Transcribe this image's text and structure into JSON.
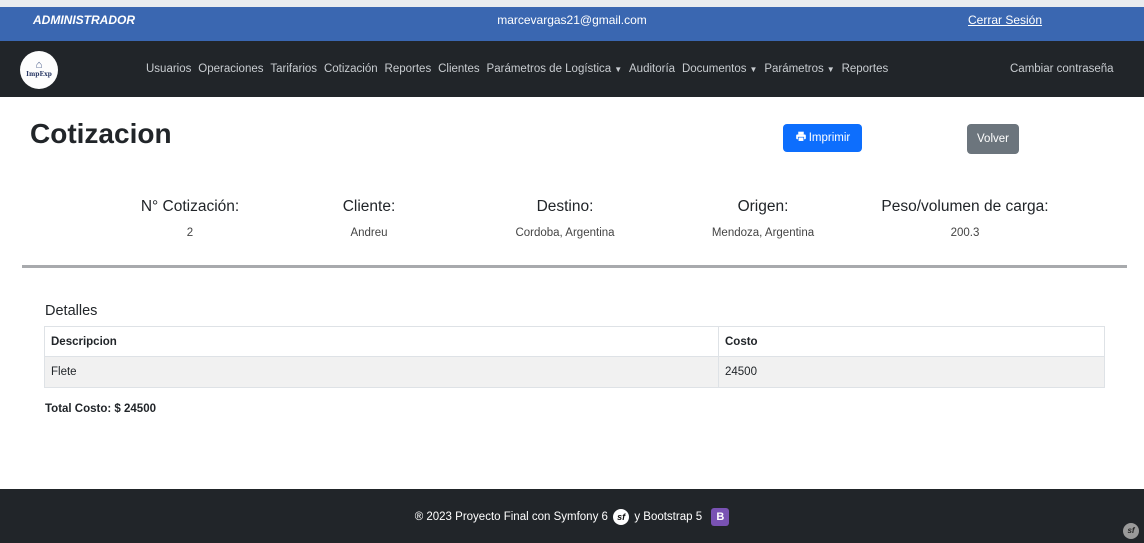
{
  "topbar": {
    "role": "ADMINISTRADOR",
    "email": "marcevargas21@gmail.com",
    "logout": "Cerrar Sesión"
  },
  "navbar": {
    "logo_text": "ImpExp",
    "items": [
      {
        "label": "Usuarios",
        "dropdown": false
      },
      {
        "label": "Operaciones",
        "dropdown": false
      },
      {
        "label": "Tarifarios",
        "dropdown": false
      },
      {
        "label": "Cotización",
        "dropdown": false
      },
      {
        "label": "Reportes",
        "dropdown": false
      },
      {
        "label": "Clientes",
        "dropdown": false
      },
      {
        "label": "Parámetros de Logística",
        "dropdown": true
      },
      {
        "label": "Auditoría",
        "dropdown": false
      },
      {
        "label": "Documentos",
        "dropdown": true
      },
      {
        "label": "Parámetros",
        "dropdown": true
      },
      {
        "label": "Reportes",
        "dropdown": false
      }
    ],
    "right_link": "Cambiar contraseña"
  },
  "page": {
    "title": "Cotizacion",
    "print_button": "Imprimir",
    "back_button": "Volver"
  },
  "summary": {
    "numero_label": "N° Cotización:",
    "numero_value": "2",
    "cliente_label": "Cliente:",
    "cliente_value": "Andreu",
    "destino_label": "Destino:",
    "destino_value": "Cordoba, Argentina",
    "origen_label": "Origen:",
    "origen_value": "Mendoza, Argentina",
    "peso_label": "Peso/volumen de carga:",
    "peso_value": "200.3"
  },
  "details": {
    "title": "Detalles",
    "columns": [
      "Descripcion",
      "Costo"
    ],
    "rows": [
      {
        "descripcion": "Flete",
        "costo": "24500"
      }
    ],
    "total": "Total Costo: $ 24500"
  },
  "footer": {
    "text_before": "® 2023 Proyecto Final con Symfony 6",
    "text_after": "y Bootstrap 5"
  },
  "icons": {
    "print": "printer-icon",
    "symfony": "symfony-logo-icon",
    "bootstrap": "bootstrap-logo-icon",
    "caret": "caret-down-icon"
  },
  "colors": {
    "topbar": "#3a67b1",
    "navbar": "#212529",
    "primary": "#0d6efd",
    "secondary": "#6c757d"
  }
}
